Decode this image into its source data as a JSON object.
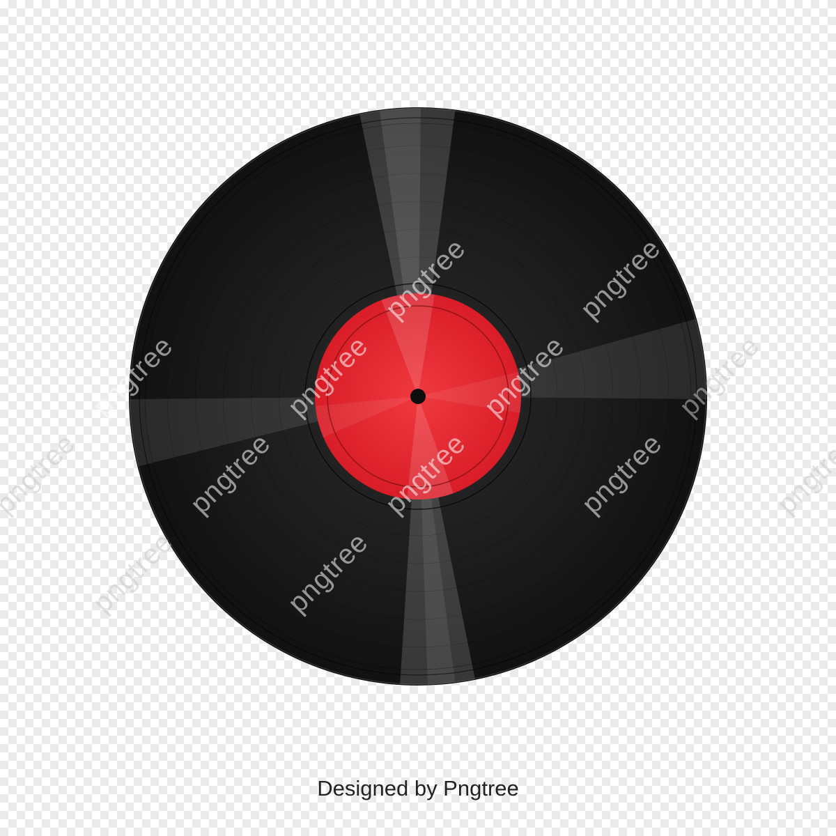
{
  "watermark": {
    "text": "pngtree"
  },
  "footer": {
    "credit": "Designed by Pngtree"
  },
  "record": {
    "vinyl_color": "#1a1a1a",
    "label_color": "#e5202c",
    "spindle_color": "#0d0d0d"
  }
}
